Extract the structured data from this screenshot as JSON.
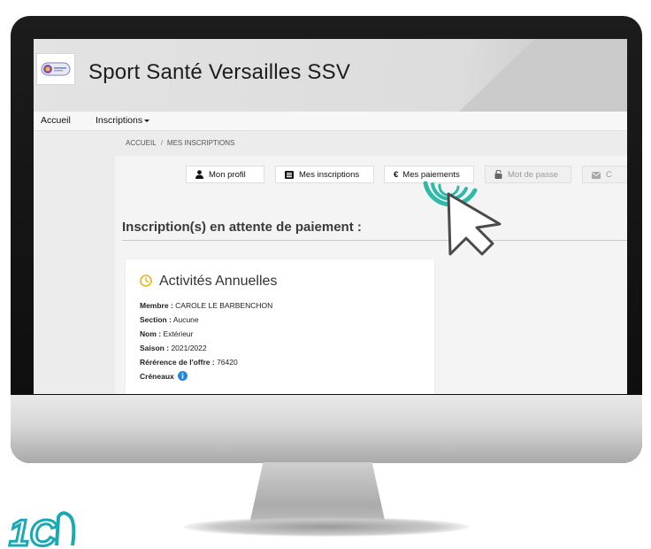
{
  "site": {
    "club_name": "Sport Santé Versailles SSV",
    "logo_icon": "club-logo-icon"
  },
  "nav": {
    "items": [
      {
        "label": "Accueil"
      },
      {
        "label": "Inscriptions"
      }
    ]
  },
  "breadcrumb": {
    "items": [
      "ACCUEIL",
      "MES INSCRIPTIONS"
    ],
    "separator": "/"
  },
  "tabs": [
    {
      "label": "Mon profil",
      "icon": "user-icon",
      "state": "normal"
    },
    {
      "label": "Mes inscriptions",
      "icon": "list-icon",
      "state": "normal"
    },
    {
      "label": "Mes paiements",
      "icon": "euro-icon",
      "state": "active"
    },
    {
      "label": "Mot de passe",
      "icon": "lock-icon",
      "state": "disabled"
    },
    {
      "label": "C",
      "icon": "mail-icon",
      "state": "disabled"
    }
  ],
  "main": {
    "section_title": "Inscription(s) en attente de paiement :"
  },
  "card": {
    "title": "Activités Annuelles",
    "icon": "clock-icon",
    "rows": [
      {
        "label": "Membre :",
        "value": "CAROLE LE BARBENCHON"
      },
      {
        "label": "Section :",
        "value": "Aucune"
      },
      {
        "label": "Nom :",
        "value": "Extérieur"
      },
      {
        "label": "Saison :",
        "value": "2021/2022"
      },
      {
        "label": "Rérérence de l'offre :",
        "value": "76420"
      },
      {
        "label": "Créneaux",
        "value": ""
      }
    ]
  },
  "colors": {
    "accent_teal": "#2fb9a8",
    "clock_yellow": "#e8b518",
    "info_blue": "#1e88e5"
  }
}
